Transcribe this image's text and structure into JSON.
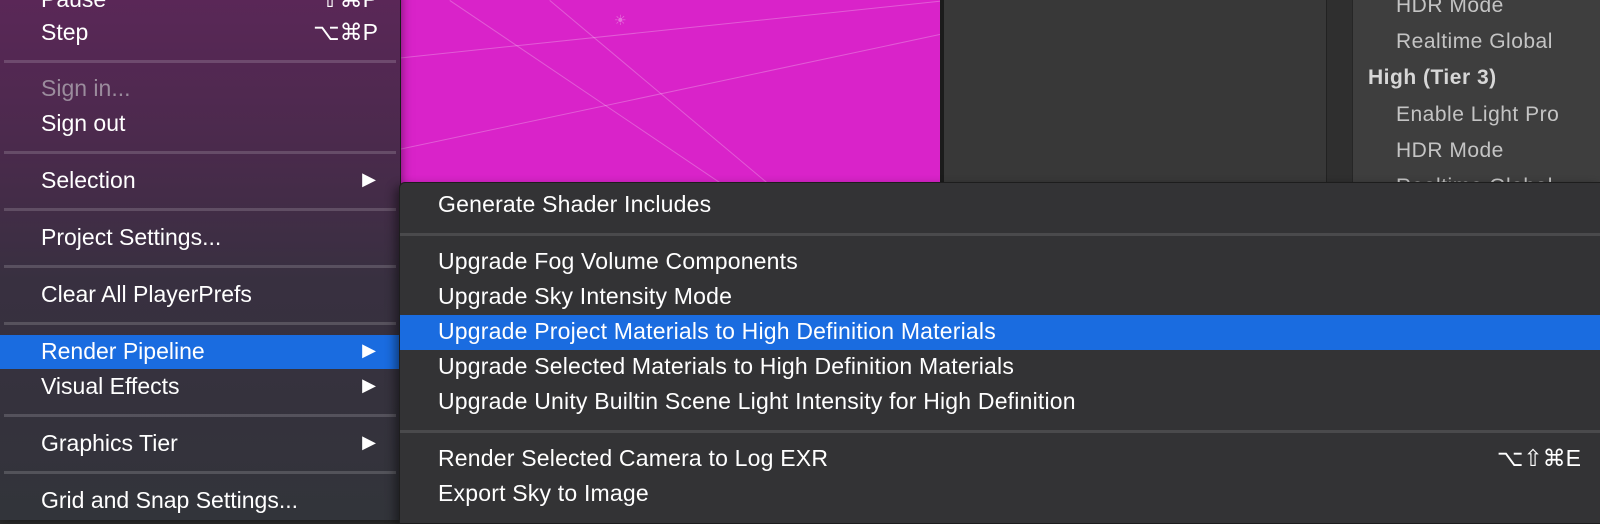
{
  "inspector": {
    "rows": [
      {
        "text": "HDR Mode",
        "header": false
      },
      {
        "text": "Realtime Global",
        "header": false
      },
      {
        "text": "High (Tier 3)",
        "header": true
      },
      {
        "text": "Enable Light Pro",
        "header": false
      },
      {
        "text": "HDR Mode",
        "header": false
      },
      {
        "text": "Realtime Global",
        "header": false
      }
    ]
  },
  "menu": {
    "pause_label": "Pause",
    "pause_shortcut": "⇧⌘P",
    "step_label": "Step",
    "step_shortcut": "⌥⌘P",
    "sign_in_label": "Sign in...",
    "sign_out_label": "Sign out",
    "selection_label": "Selection",
    "project_settings_label": "Project Settings...",
    "clear_prefs_label": "Clear All PlayerPrefs",
    "render_pipeline_label": "Render Pipeline",
    "visual_effects_label": "Visual Effects",
    "graphics_tier_label": "Graphics Tier",
    "grid_snap_label": "Grid and Snap Settings...",
    "submenu_arrow": "▶"
  },
  "submenu": {
    "generate_shader_label": "Generate Shader Includes",
    "upgrade_fog_label": "Upgrade Fog Volume Components",
    "upgrade_sky_label": "Upgrade Sky Intensity Mode",
    "upgrade_project_label": "Upgrade Project Materials to High Definition Materials",
    "upgrade_selected_label": "Upgrade Selected Materials to High Definition Materials",
    "upgrade_light_label": "Upgrade Unity Builtin Scene Light Intensity for High Definition",
    "render_camera_label": "Render Selected Camera to Log EXR",
    "render_camera_shortcut": "⌥⇧⌘E",
    "export_sky_label": "Export Sky to Image"
  },
  "colors": {
    "selection_highlight": "#1a6ce0",
    "scene_magenta": "#d923c9",
    "menu_bg": "#333335"
  },
  "icons": {
    "submenu_arrow": "triangle-right-icon",
    "scene_gizmo": "sun-icon"
  }
}
